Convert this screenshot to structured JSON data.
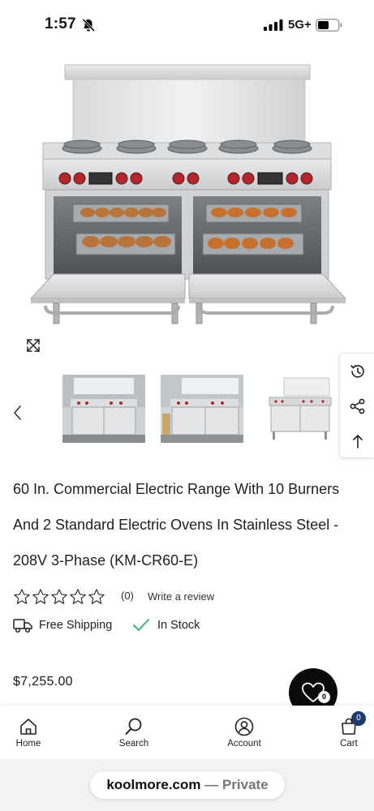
{
  "status_bar": {
    "time": "1:57",
    "network": "5G+"
  },
  "product": {
    "title": "60 In. Commercial Electric Range With 10 Burners And 2 Standard Electric Ovens In Stainless Steel - 208V 3-Phase (KM-CR60-E)",
    "review_count": "(0)",
    "write_review": "Write a review",
    "rating": 0,
    "rating_max": 5,
    "shipping": "Free Shipping",
    "stock": "In Stock",
    "price": "$7,255.00"
  },
  "wishlist": {
    "count": "0"
  },
  "bottom_nav": {
    "home": "Home",
    "search": "Search",
    "account": "Account",
    "cart": "Cart",
    "cart_count": "0"
  },
  "url_bar": {
    "domain": "koolmore.com",
    "mode": "— Private"
  },
  "icons": {
    "status": [
      "bell-off-icon",
      "signal-icon",
      "battery-icon"
    ],
    "actions": [
      "expand-icon",
      "chevron-left-icon",
      "history-icon",
      "share-icon",
      "arrow-up-icon",
      "heart-icon"
    ],
    "info": [
      "truck-icon",
      "check-icon",
      "star-icon"
    ],
    "nav": [
      "home-icon",
      "search-icon",
      "account-icon",
      "cart-icon"
    ]
  },
  "colors": {
    "check": "#3cb371",
    "cart_badge": "#1c3a6e",
    "fab": "#0b0b0b",
    "knob_red": "#b3262b"
  }
}
